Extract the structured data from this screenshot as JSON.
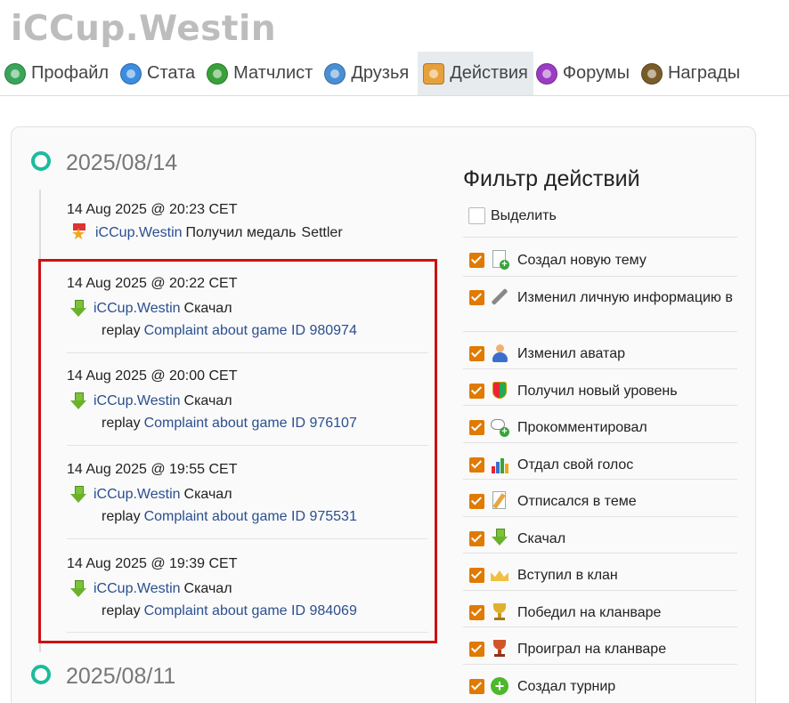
{
  "page_title": "iCCup.Westin",
  "nav": [
    {
      "label": "Профайл",
      "color": "#3aa55a",
      "active": false
    },
    {
      "label": "Стата",
      "color": "#3c8de0",
      "active": false
    },
    {
      "label": "Матчлист",
      "color": "#3aa13a",
      "active": false
    },
    {
      "label": "Друзья",
      "color": "#4a8fd4",
      "active": false
    },
    {
      "label": "Действия",
      "color": "#e7a13c",
      "active": true
    },
    {
      "label": "Форумы",
      "color": "#9b3cc4",
      "active": false
    },
    {
      "label": "Награды",
      "color": "#7a5c2a",
      "active": false
    }
  ],
  "timeline": {
    "groups": [
      {
        "date": "2025/08/14",
        "entries": [
          {
            "time": "14 Aug 2025 @ 20:23 CET",
            "icon": "medal-icon",
            "user": "iCCup.Westin",
            "action": "Получил медаль",
            "detail": "Settler"
          },
          {
            "time": "14 Aug 2025 @ 20:22 CET",
            "icon": "download-icon",
            "user": "iCCup.Westin",
            "action": "Скачал",
            "replay_prefix": "replay",
            "replay_link": "Complaint about game ID 980974"
          },
          {
            "time": "14 Aug 2025 @ 20:00 CET",
            "icon": "download-icon",
            "user": "iCCup.Westin",
            "action": "Скачал",
            "replay_prefix": "replay",
            "replay_link": "Complaint about game ID 976107"
          },
          {
            "time": "14 Aug 2025 @ 19:55 CET",
            "icon": "download-icon",
            "user": "iCCup.Westin",
            "action": "Скачал",
            "replay_prefix": "replay",
            "replay_link": "Complaint about game ID 975531"
          },
          {
            "time": "14 Aug 2025 @ 19:39 CET",
            "icon": "download-icon",
            "user": "iCCup.Westin",
            "action": "Скачал",
            "replay_prefix": "replay",
            "replay_link": "Complaint about game ID 984069"
          }
        ]
      },
      {
        "date": "2025/08/11",
        "entries": []
      }
    ]
  },
  "filter": {
    "title": "Фильтр действий",
    "select_all": "Выделить",
    "items": [
      {
        "label": "Создал новую тему",
        "icon": "new-topic-icon",
        "checked": true
      },
      {
        "label": "Изменил личную информацию в",
        "icon": "wrench-icon",
        "checked": true
      },
      {
        "label": "Изменил аватар",
        "icon": "avatar-icon",
        "checked": true
      },
      {
        "label": "Получил новый уровень",
        "icon": "level-shield-icon",
        "checked": true
      },
      {
        "label": "Прокомментировал",
        "icon": "comment-icon",
        "checked": true
      },
      {
        "label": "Отдал свой голос",
        "icon": "vote-chart-icon",
        "checked": true
      },
      {
        "label": "Отписался в теме",
        "icon": "post-edit-icon",
        "checked": true
      },
      {
        "label": "Скачал",
        "icon": "download-icon",
        "checked": true
      },
      {
        "label": "Вступил в клан",
        "icon": "clan-crown-icon",
        "checked": true
      },
      {
        "label": "Победил на кланваре",
        "icon": "trophy-gold-icon",
        "checked": true
      },
      {
        "label": "Проиграл на кланваре",
        "icon": "trophy-red-icon",
        "checked": true
      },
      {
        "label": "Создал турнир",
        "icon": "add-tournament-icon",
        "checked": true
      }
    ]
  },
  "colors": {
    "accent_link": "#2a4f8f",
    "timeline_dot": "#1abc9c",
    "checkbox": "#e07a00",
    "highlight": "#cc1111"
  }
}
